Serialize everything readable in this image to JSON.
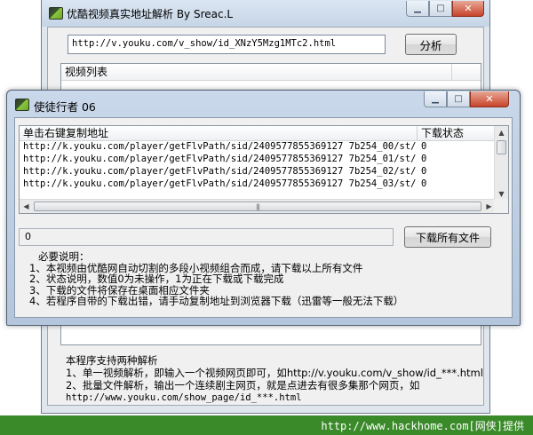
{
  "main_window": {
    "title": "优酷视频真实地址解析 By Sreac.L",
    "url_value": "http://v.youku.com/v_show/id_XNzY5Mzg1MTc2.html",
    "parse_button": "分析",
    "list_header": "视频列表",
    "info_lines": [
      "本程序支持两种解析",
      "1、单一视频解析，即输入一个视频网页即可，如http://v.youku.com/v_show/id_***.html",
      "2、批量文件解析，输出一个连续剧主网页，就是点进去有很多集那个网页，如",
      "http://www.youku.com/show_page/id_***.html"
    ]
  },
  "dialog": {
    "title": "使徒行者 06",
    "columns": [
      "单击右键复制地址",
      "下载状态"
    ],
    "rows": [
      {
        "url": "http://k.youku.com/player/getFlvPath/sid/2409577855369127 7b254_00/st/fl...",
        "status": "0"
      },
      {
        "url": "http://k.youku.com/player/getFlvPath/sid/2409577855369127 7b254_01/st/fl...",
        "status": "0"
      },
      {
        "url": "http://k.youku.com/player/getFlvPath/sid/2409577855369127 7b254_02/st/fl...",
        "status": "0"
      },
      {
        "url": "http://k.youku.com/player/getFlvPath/sid/2409577855369127 7b254_03/st/fl...",
        "status": "0"
      }
    ],
    "status_value": "0",
    "download_all_button": "下载所有文件",
    "notes": [
      "必要说明：",
      "1、本视频由优酷网自动切割的多段小视频组合而成，请下载以上所有文件",
      "2、状态说明，数值0为未操作，1为正在下载或下载完成",
      "3、下载的文件将保存在桌面相应文件夹",
      "4、若程序自带的下载出错，请手动复制地址到浏览器下载（迅雷等一般无法下载）"
    ]
  },
  "watermark": "http://www.hackhome.com[网侠]提供",
  "colors": {
    "title_bar": "#c6d5e6",
    "client": "#f0f0f0",
    "close_button": "#c7432b",
    "watermark_bg": "#3a8a2a"
  }
}
